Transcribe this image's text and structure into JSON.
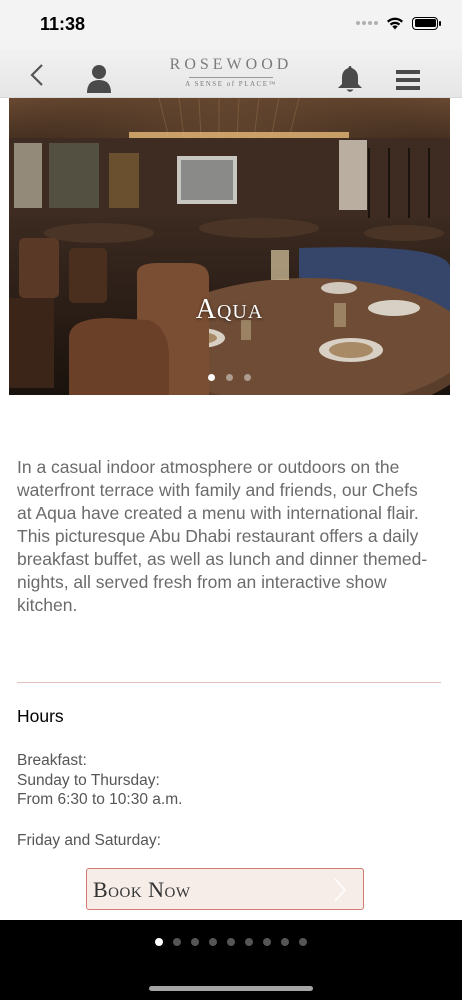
{
  "status_bar": {
    "time": "11:38"
  },
  "header": {
    "logo_word": "ROSEWOOD",
    "logo_tagline": "A SENSE of PLACE™"
  },
  "hero": {
    "title": "Aqua",
    "slide_count": 3,
    "active_slide": 0
  },
  "description": {
    "text": " In a casual indoor atmosphere or outdoors on the waterfront terrace with family and friends, our Chefs at Aqua have created a menu with international flair.\nThis picturesque Abu Dhabi restaurant offers a daily breakfast buffet, as well as lunch and dinner themed-nights, all served fresh from an interactive show kitchen."
  },
  "hours": {
    "heading": "Hours",
    "breakfast_label": "Breakfast:",
    "weekday_label": "Sunday to Thursday:",
    "weekday_time": "From 6:30 to 10:30 a.m.",
    "weekend_label": "Friday and Saturday:"
  },
  "book_button": {
    "label": "Book Now"
  },
  "pager": {
    "page_count": 9,
    "active_page": 0
  },
  "colors": {
    "divider": "#e5c0bd",
    "button_border": "#d07a72",
    "button_bg": "#f6ece8"
  }
}
